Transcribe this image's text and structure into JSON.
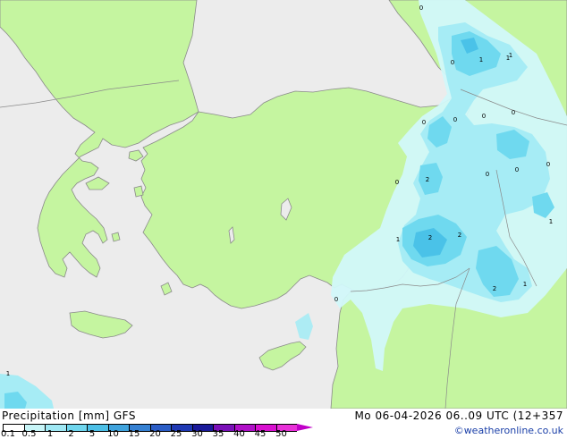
{
  "map": {
    "colors": {
      "sea": "#ececec",
      "land": "#c5f5a0",
      "coast": "#8a8a8a",
      "border": "#8a8a8a"
    },
    "precip_colors": [
      "#d2f8fa",
      "#a6ecf5",
      "#6fd9ef",
      "#4ac2e8"
    ],
    "point_labels": [
      {
        "text": "0"
      },
      {
        "text": "1"
      },
      {
        "text": "1"
      },
      {
        "text": "0"
      },
      {
        "text": "0"
      },
      {
        "text": "0"
      },
      {
        "text": "0"
      },
      {
        "text": "0"
      },
      {
        "text": "0"
      },
      {
        "text": "2"
      },
      {
        "text": "0"
      },
      {
        "text": "0"
      },
      {
        "text": "0"
      },
      {
        "text": "1"
      },
      {
        "text": "2"
      },
      {
        "text": "2"
      },
      {
        "text": "1"
      },
      {
        "text": "1"
      },
      {
        "text": "2"
      },
      {
        "text": "1"
      },
      {
        "text": "0"
      },
      {
        "text": "1"
      }
    ]
  },
  "footer": {
    "title": "Precipitation [mm] GFS",
    "datetime": "Mo 06-04-2026 06..09 UTC (12+357",
    "credit": "©weatheronline.co.uk",
    "legend": {
      "ticks": [
        "0.1",
        "0.5",
        "1",
        "2",
        "5",
        "10",
        "15",
        "20",
        "25",
        "30",
        "35",
        "40",
        "45",
        "50"
      ],
      "colors": [
        "#ffffff",
        "#c8f5f8",
        "#9fe8f4",
        "#6fd6ee",
        "#4cbfe6",
        "#3fa3dd",
        "#3580d2",
        "#2b5dc6",
        "#1f39b4",
        "#1a1a9a",
        "#7a10b8",
        "#b010c8",
        "#d810d0",
        "#e830d8"
      ],
      "arrow_color": "#c000c8"
    }
  }
}
